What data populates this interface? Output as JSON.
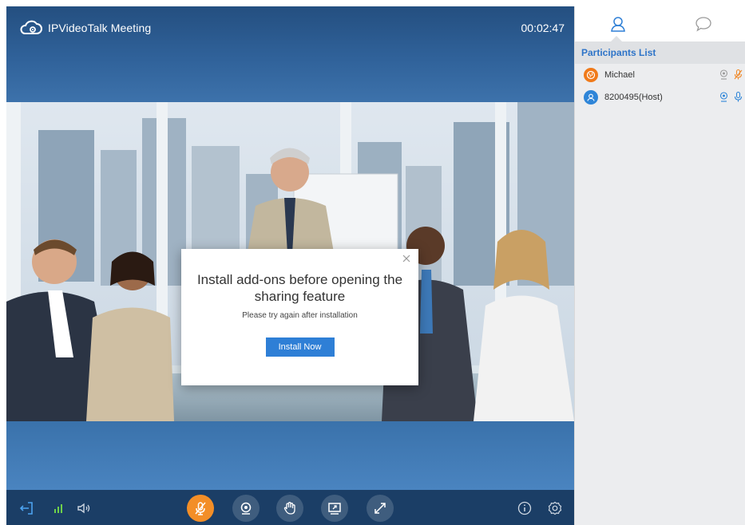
{
  "header": {
    "title": "IPVideoTalk Meeting",
    "timer": "00:02:47",
    "logo_icon": "cloud-camera-icon"
  },
  "dialog": {
    "title": "Install add-ons before opening the sharing feature",
    "message": "Please try again after installation",
    "button_label": "Install Now",
    "close_icon": "close-icon"
  },
  "toolbar": {
    "items": [
      {
        "name": "exit-icon",
        "interactable": true
      },
      {
        "name": "signal-icon",
        "interactable": false
      },
      {
        "name": "speaker-icon",
        "interactable": true
      },
      {
        "name": "mute-microphone-icon",
        "interactable": true,
        "active": true
      },
      {
        "name": "camera-icon",
        "interactable": true
      },
      {
        "name": "raise-hand-icon",
        "interactable": true
      },
      {
        "name": "share-screen-icon",
        "interactable": true
      },
      {
        "name": "fullscreen-icon",
        "interactable": true
      },
      {
        "name": "info-icon",
        "interactable": true
      },
      {
        "name": "settings-icon",
        "interactable": true
      }
    ]
  },
  "sidebar": {
    "tabs": [
      {
        "name": "participants-icon",
        "active": true
      },
      {
        "name": "chat-icon",
        "active": false
      }
    ],
    "list_title": "Participants List",
    "participants": [
      {
        "name": "Michael",
        "avatar_color": "#f07a1a",
        "avatar_icon": "globe-icon",
        "camera_color": "#9a9a9a",
        "mic_color": "#f08a2a"
      },
      {
        "name": "8200495(Host)",
        "avatar_color": "#2e85d8",
        "avatar_icon": "user-icon",
        "camera_color": "#2e85d8",
        "mic_color": "#2e85d8"
      }
    ]
  },
  "colors": {
    "accent_blue": "#2e7fd6",
    "accent_orange": "#f38e27",
    "toolbar_bg": "#1b3e66",
    "list_title": "#2e74c8"
  }
}
